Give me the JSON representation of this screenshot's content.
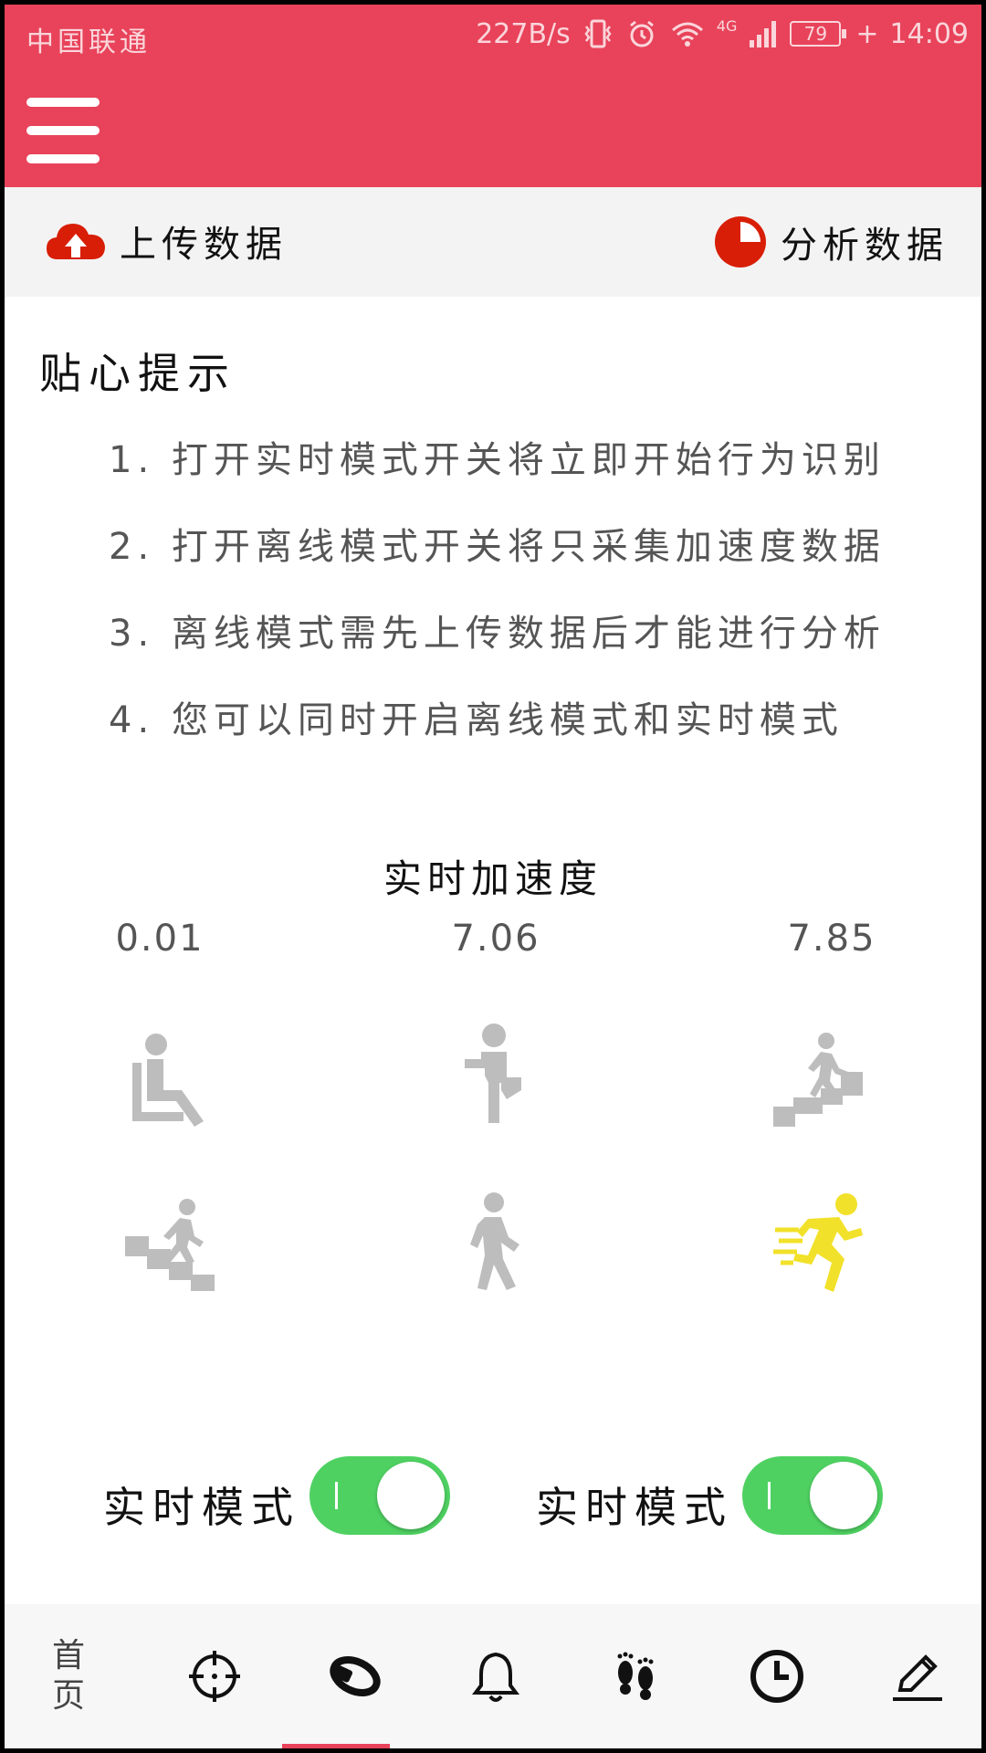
{
  "status_bar": {
    "carrier": "中国联通",
    "net_speed": "227B/s",
    "network": "4G",
    "battery": "79",
    "time": "14:09"
  },
  "toolbar": {
    "menu_icon": "hamburger-menu-icon",
    "upload_label": "上传数据",
    "upload_icon": "cloud-upload-icon",
    "analyze_label": "分析数据",
    "analyze_icon": "pie-chart-icon"
  },
  "tips": {
    "title": "贴心提示",
    "items": [
      "1. 打开实时模式开关将立即开始行为识别",
      "2. 打开离线模式开关将只采集加速度数据",
      "3. 离线模式需先上传数据后才能进行分析",
      "4. 您可以同时开启离线模式和实时模式"
    ]
  },
  "acceleration": {
    "title": "实时加速度",
    "values": [
      "0.01",
      "7.06",
      "7.85"
    ]
  },
  "activities": [
    {
      "name": "sitting",
      "icon": "sitting-person-icon",
      "active": false
    },
    {
      "name": "standing",
      "icon": "standing-person-icon",
      "active": false
    },
    {
      "name": "upstairs",
      "icon": "walking-upstairs-icon",
      "active": false
    },
    {
      "name": "downstairs",
      "icon": "walking-downstairs-icon",
      "active": false
    },
    {
      "name": "walking",
      "icon": "walking-person-icon",
      "active": false
    },
    {
      "name": "running",
      "icon": "running-person-icon",
      "active": true
    }
  ],
  "colors": {
    "brand": "#e8435a",
    "inactive_icon": "#bdbdbd",
    "active_icon": "#f2e12a",
    "switch_on": "#4fd162"
  },
  "switches": [
    {
      "label": "实时模式",
      "on": true
    },
    {
      "label": "实时模式",
      "on": true
    }
  ],
  "bottom_nav": {
    "home_label": "首页",
    "icons": [
      "crosshair-icon",
      "wristband-icon",
      "bell-icon",
      "footprints-icon",
      "clock-icon",
      "pencil-icon"
    ]
  }
}
